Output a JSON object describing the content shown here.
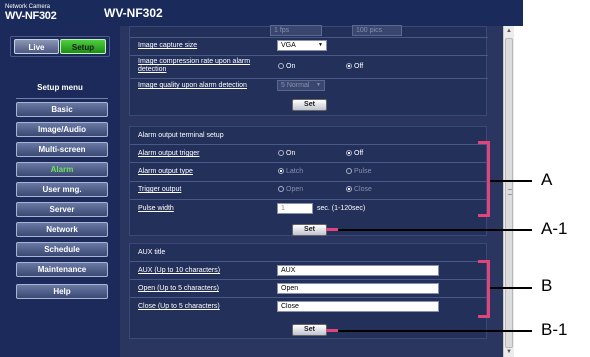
{
  "brand": {
    "small": "Network Camera",
    "model": "WV-NF302"
  },
  "header": {
    "model": "WV-NF302"
  },
  "mode": {
    "live": "Live",
    "setup": "Setup"
  },
  "sidebar": {
    "menu_label": "Setup menu",
    "items": [
      "Basic",
      "Image/Audio",
      "Multi-screen",
      "Alarm",
      "User mng.",
      "Server",
      "Network",
      "Schedule",
      "Maintenance",
      "Help"
    ],
    "active": "Alarm"
  },
  "image_section": {
    "top_select1": "1 fps",
    "top_select2": "100 pics",
    "capture_size_label": "Image capture size",
    "capture_size_value": "VGA",
    "compression_label": "Image compression rate upon alarm detection",
    "compression_on": "On",
    "compression_off": "Off",
    "quality_label": "Image quality upon alarm detection",
    "quality_value": "5 Normal",
    "set_label": "Set"
  },
  "alarm_output": {
    "title": "Alarm output terminal setup",
    "trigger_label": "Alarm output trigger",
    "trigger_on": "On",
    "trigger_off": "Off",
    "type_label": "Alarm output type",
    "type_latch": "Latch",
    "type_pulse": "Pulse",
    "trigger_output_label": "Trigger output",
    "output_open": "Open",
    "output_close": "Close",
    "pulse_width_label": "Pulse width",
    "pulse_width_value": "1",
    "pulse_width_unit": "sec. (1-120sec)",
    "set_label": "Set"
  },
  "aux_title": {
    "title": "AUX title",
    "aux_label": "AUX (Up to 10 characters)",
    "aux_value": "AUX",
    "open_label": "Open (Up to 5 characters)",
    "open_value": "Open",
    "close_label": "Close (Up to 5 characters)",
    "close_value": "Close",
    "set_label": "Set"
  },
  "callouts": {
    "a": "A",
    "a1": "A-1",
    "b": "B",
    "b1": "B-1"
  },
  "colors": {
    "callout": "#e0447a",
    "active_menu": "#6ee35a",
    "setup_green": "#2aa81e",
    "sidebar_bg": "#1b2a5b"
  }
}
